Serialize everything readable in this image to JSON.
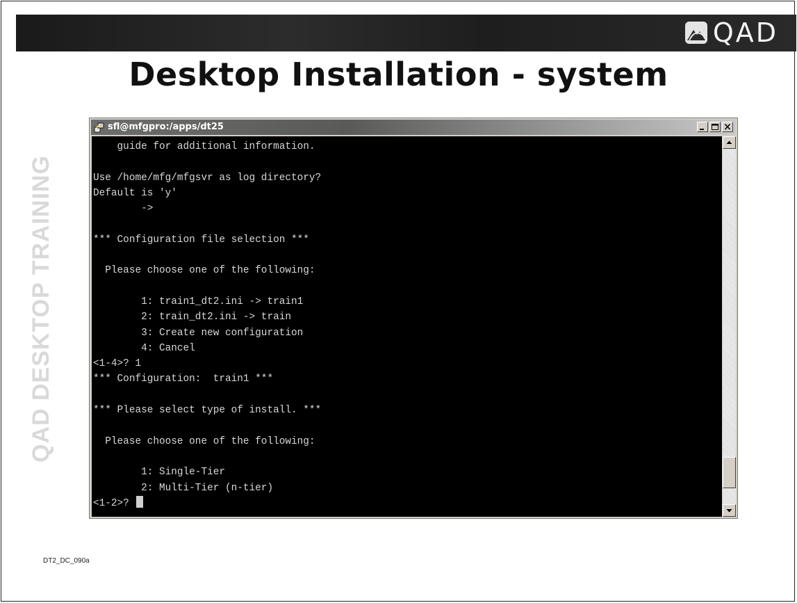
{
  "slide": {
    "title": "Desktop Installation - system",
    "watermark": "QAD DESKTOP TRAINING",
    "code": "DT2_DC_090a"
  },
  "brand": {
    "logo_text": "QAD",
    "logo_icon": "qad-mountain-logo-icon"
  },
  "terminal": {
    "window_title": "sfl@mfgpro:/apps/dt25",
    "lines": [
      "    guide for additional information.",
      "",
      "Use /home/mfg/mfgsvr as log directory?",
      "Default is 'y'",
      "        ->",
      "",
      "*** Configuration file selection ***",
      "",
      "  Please choose one of the following:",
      "",
      "        1: train1_dt2.ini -> train1",
      "        2: train_dt2.ini -> train",
      "        3: Create new configuration",
      "        4: Cancel",
      "<1-4>? 1",
      "*** Configuration:  train1 ***",
      "",
      "*** Please select type of install. ***",
      "",
      "  Please choose one of the following:",
      "",
      "        1: Single-Tier",
      "        2: Multi-Tier (n-tier)",
      "<1-2>? "
    ],
    "window_buttons": [
      "minimize-icon",
      "maximize-icon",
      "close-icon"
    ],
    "scroll_position": 0.95
  }
}
